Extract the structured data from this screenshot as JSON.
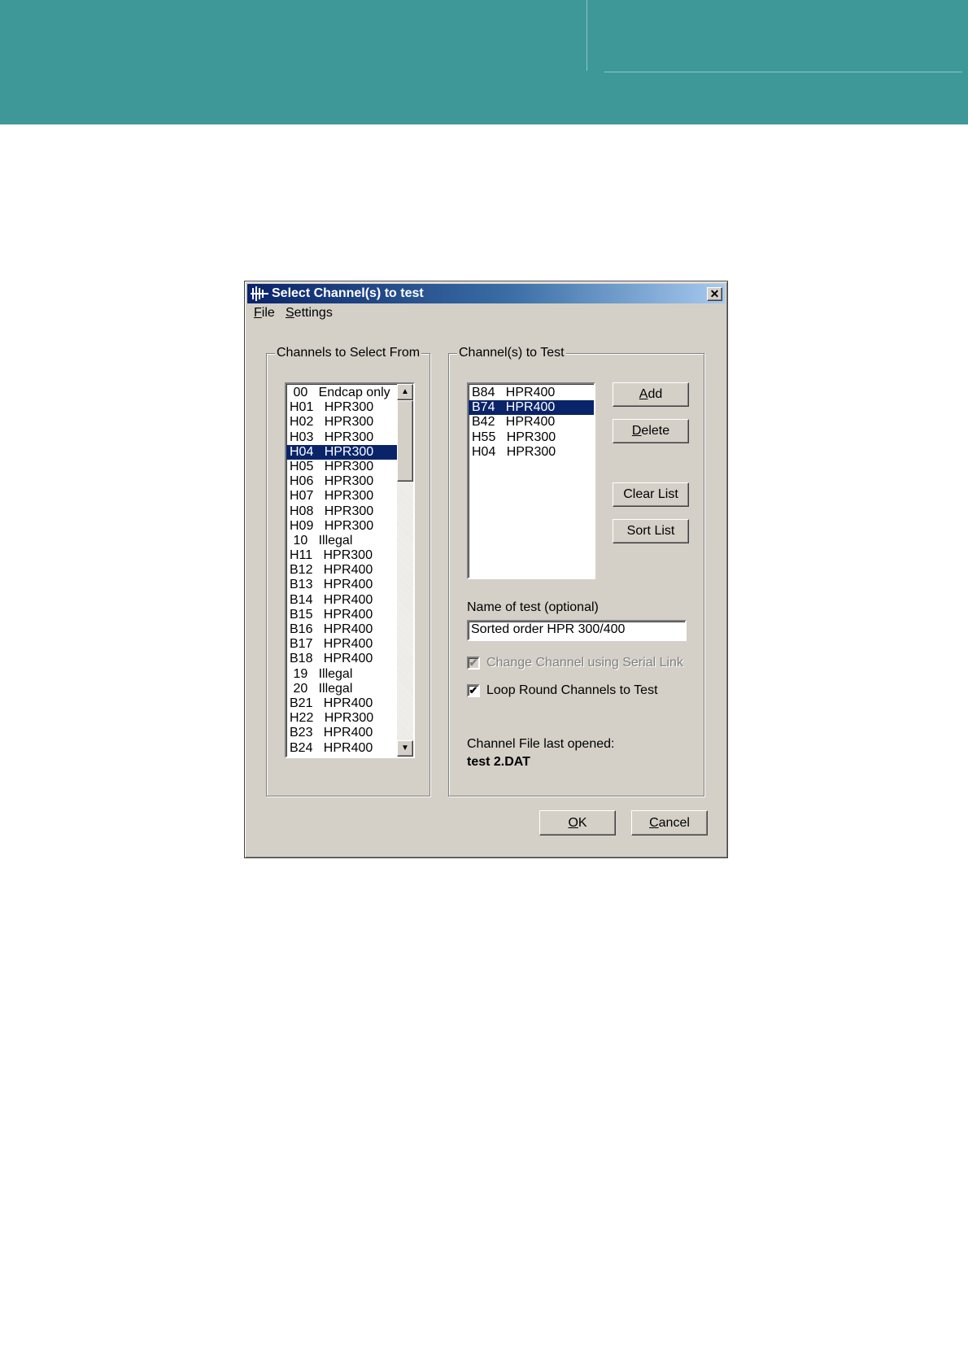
{
  "dialog": {
    "title": "Select Channel(s) to test",
    "close_symbol": "✕",
    "icon": "app-logo-icon"
  },
  "menu": {
    "file": "File",
    "settings": "Settings"
  },
  "left_group": {
    "label": "Channels to Select From",
    "items": [
      " 00   Endcap only",
      "H01   HPR300",
      "H02   HPR300",
      "H03   HPR300",
      "H04   HPR300",
      "H05   HPR300",
      "H06   HPR300",
      "H07   HPR300",
      "H08   HPR300",
      "H09   HPR300",
      " 10   Illegal",
      "H11   HPR300",
      "B12   HPR400",
      "B13   HPR400",
      "B14   HPR400",
      "B15   HPR400",
      "B16   HPR400",
      "B17   HPR400",
      "B18   HPR400",
      " 19   Illegal",
      " 20   Illegal",
      "B21   HPR400",
      "H22   HPR300",
      "B23   HPR400",
      "B24   HPR400"
    ],
    "selected_index": 4,
    "scroll_up_symbol": "▲",
    "scroll_down_symbol": "▼"
  },
  "right_group": {
    "label": "Channel(s) to Test",
    "items": [
      "B84   HPR400",
      "B74   HPR400",
      "B42   HPR400",
      "H55   HPR300",
      "H04   HPR300"
    ],
    "selected_index": 1,
    "buttons": {
      "add": "Add",
      "delete": "Delete",
      "clear_list": "Clear List",
      "sort_list": "Sort List"
    },
    "name_label": "Name of test (optional)",
    "name_value": "Sorted order HPR 300/400",
    "change_channel_label": "Change Channel using Serial Link",
    "change_channel_checked": true,
    "change_channel_enabled": false,
    "loop_round_label": "Loop Round Channels to Test",
    "loop_round_checked": true,
    "file_label": "Channel File last opened:",
    "file_name": "test 2.DAT"
  },
  "footer": {
    "ok": "OK",
    "cancel": "Cancel"
  },
  "check_symbol": "✔",
  "colors": {
    "banner": "#3e9898",
    "selection": "#0a246a",
    "dialog_face": "#d4d0c8"
  }
}
